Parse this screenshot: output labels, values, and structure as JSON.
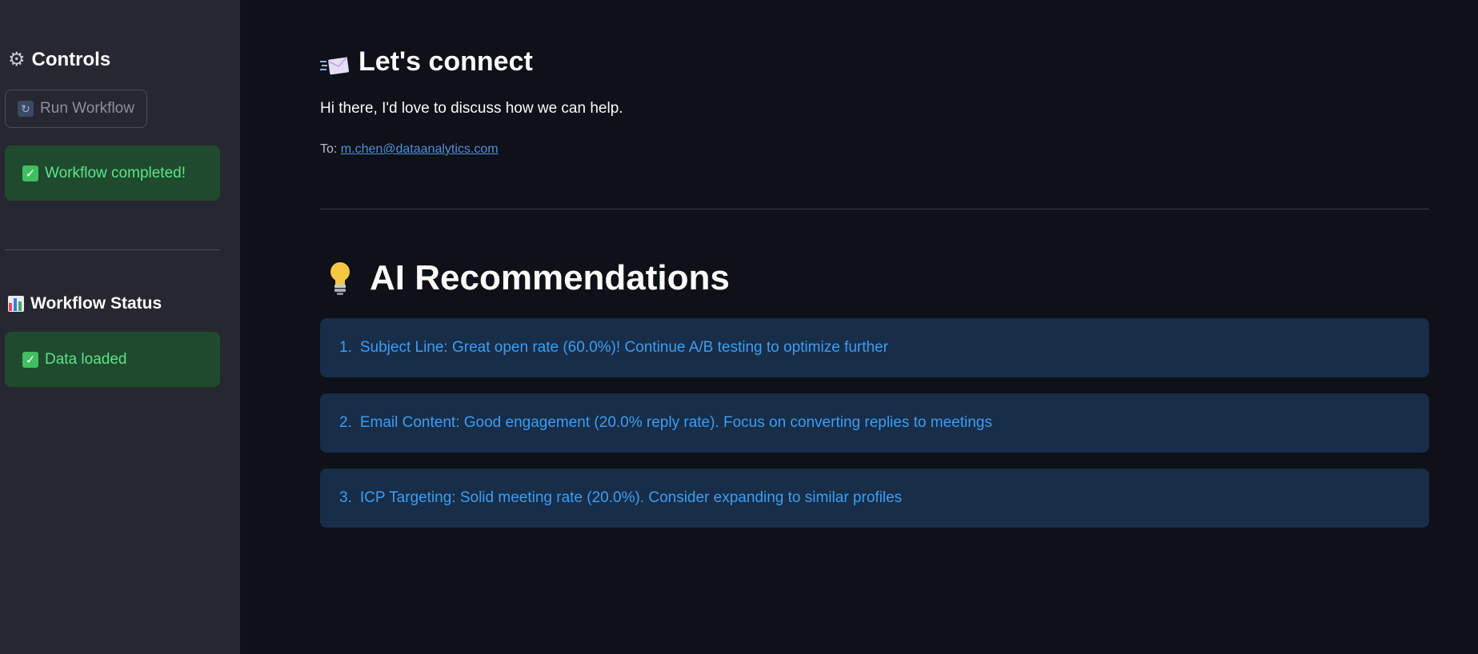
{
  "sidebar": {
    "controls_title": "Controls",
    "run_button_label": "Run Workflow",
    "workflow_completed_message": "Workflow completed!",
    "status_title": "Workflow Status",
    "data_loaded_message": "Data loaded",
    "icons": [
      "gear-icon",
      "refresh-icon",
      "check-icon",
      "bar-chart-icon"
    ]
  },
  "email": {
    "title": "Let's connect",
    "body": "Hi there, I'd love to discuss how we can help.",
    "to_label": "To:",
    "to_address": "m.chen@dataanalytics.com"
  },
  "recommendations": {
    "title": "AI Recommendations",
    "items": [
      {
        "number": "1.",
        "text": "Subject Line: Great open rate (60.0%)! Continue A/B testing to optimize further"
      },
      {
        "number": "2.",
        "text": "Email Content: Good engagement (20.0% reply rate). Focus on converting replies to meetings"
      },
      {
        "number": "3.",
        "text": "ICP Targeting: Solid meeting rate (20.0%). Consider expanding to similar profiles"
      }
    ]
  },
  "colors": {
    "background": "#0e1117",
    "sidebar": "#262730",
    "success_bg": "#1f4a2e",
    "success_text": "#5ce488",
    "info_bg": "#172d48",
    "info_text": "#3d9df3",
    "link": "#4d8fe0"
  }
}
